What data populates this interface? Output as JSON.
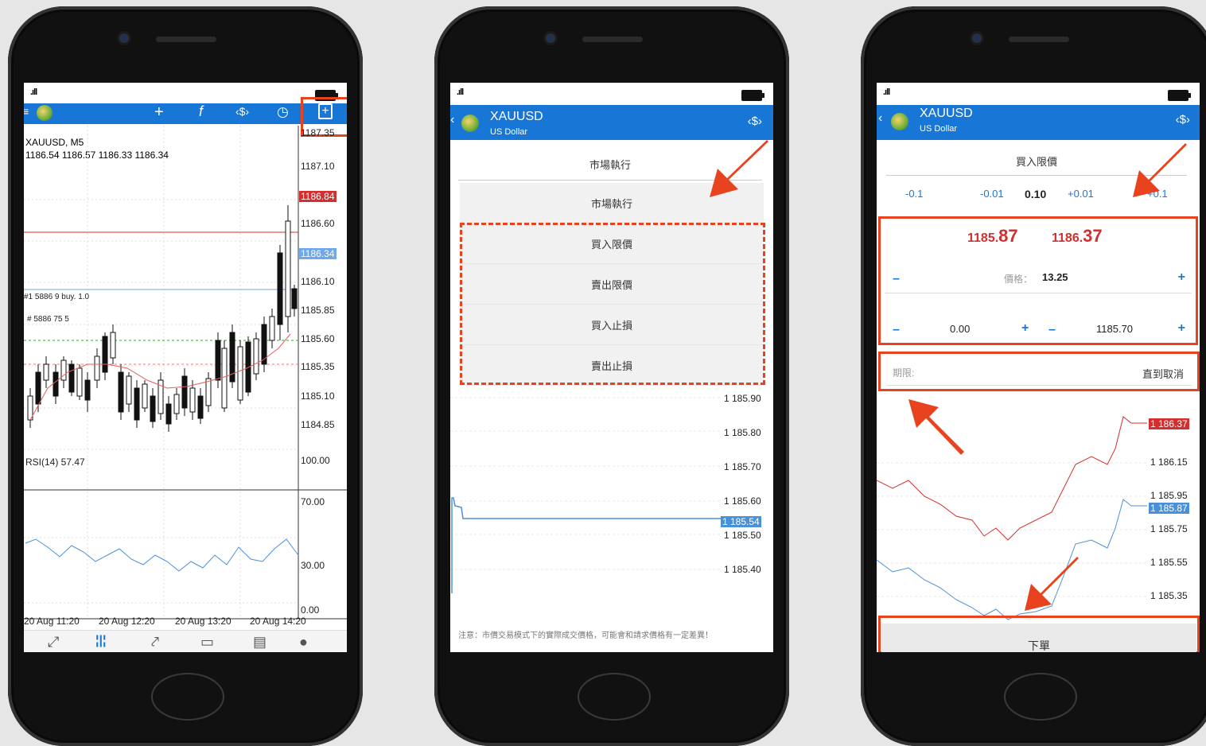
{
  "phone1": {
    "chart_header": {
      "symbol": "XAUUSD, M5",
      "ohlc": "1186.54 1186.57 1186.33 1186.34"
    },
    "price_axis": [
      "1187.35",
      "1187.10",
      "1186.84",
      "1186.60",
      "1186.34",
      "1186.10",
      "1185.85",
      "1185.60",
      "1185.35",
      "1185.10",
      "1184.85"
    ],
    "price_highlight_red": "1186.84",
    "price_highlight_blue": "1186.34",
    "rsi_label": "RSI(14) 57.47",
    "rsi_axis": [
      "100.00",
      "70.00",
      "30.00",
      "0.00"
    ],
    "time_axis": [
      "20 Aug 11:20",
      "20 Aug 12:20",
      "20 Aug 13:20",
      "20 Aug 14:20"
    ],
    "order_labels": [
      "#1 5886 9 buy. 1.0",
      "# 5886 75 5"
    ],
    "toolbar_icons": [
      "menu-icon",
      "logo-icon",
      "crosshair-icon",
      "function-icon",
      "currency-icon",
      "clock-icon",
      "new-order-icon"
    ],
    "bottom_nav_icons": [
      "quotes-icon",
      "chart-icon",
      "trade-icon",
      "history-icon",
      "news-icon",
      "chat-icon"
    ]
  },
  "phone2": {
    "title": "XAUUSD",
    "subtitle": "US Dollar",
    "select_label": "市場執行",
    "menu": [
      "市場執行",
      "買入限價",
      "賣出限價",
      "買入止損",
      "賣出止損"
    ],
    "price_axis": [
      "1 185.90",
      "1 185.80",
      "1 185.70",
      "1 185.60",
      "1 185.54",
      "1 185.50",
      "1 185.40"
    ],
    "note": "注意：市價交易模式下的實際成交價格，可能會和請求價格有一定差異！"
  },
  "phone3": {
    "title": "XAUUSD",
    "subtitle": "US Dollar",
    "order_type": "買入限價",
    "volume_steps": {
      "m1": "-0.1",
      "m01": "-0.01",
      "value": "0.10",
      "p01": "+0.01",
      "p1": "+0.1"
    },
    "bid": {
      "main": "1185.",
      "big": "87"
    },
    "ask": {
      "main": "1186.",
      "big": "37"
    },
    "price_label": "價格：",
    "price_value": "13.25",
    "sl_value": "0.00",
    "tp_value": "1185.70",
    "expiry_label": "期限:",
    "expiry_value": "直到取消",
    "price_axis": [
      "1 186.37",
      "1 186.15",
      "1 185.95",
      "1 185.87",
      "1 185.75",
      "1 185.55",
      "1 185.35"
    ],
    "submit_label": "下單"
  },
  "colors": {
    "accent": "#1877d6",
    "highlight": "#e8421e",
    "bear_red": "#d32f2f",
    "bull_blue": "#1877d6"
  }
}
